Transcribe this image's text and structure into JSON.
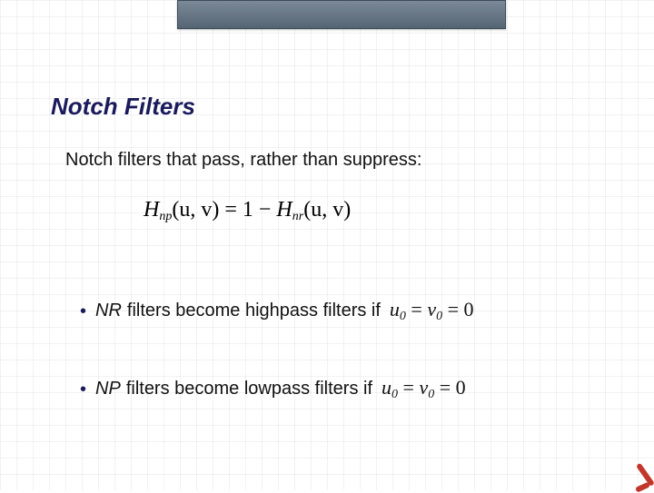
{
  "title": "Notch Filters",
  "subtitle": "Notch filters that pass, rather than suppress:",
  "equation": {
    "lhs_func": "H",
    "lhs_sub": "np",
    "args": "(u, v)",
    "eq": " = 1 − ",
    "rhs_func": "H",
    "rhs_sub": "nr",
    "rhs_args": "(u, v)"
  },
  "bullets": [
    {
      "term": "NR",
      "rest": " filters become highpass filters if",
      "cond_u_sub": "0",
      "cond_v_sub": "0",
      "cond_zero": "0"
    },
    {
      "term": "NP",
      "rest": " filters become lowpass filters if",
      "cond_u_sub": "0",
      "cond_v_sub": "0",
      "cond_zero": "0"
    }
  ]
}
